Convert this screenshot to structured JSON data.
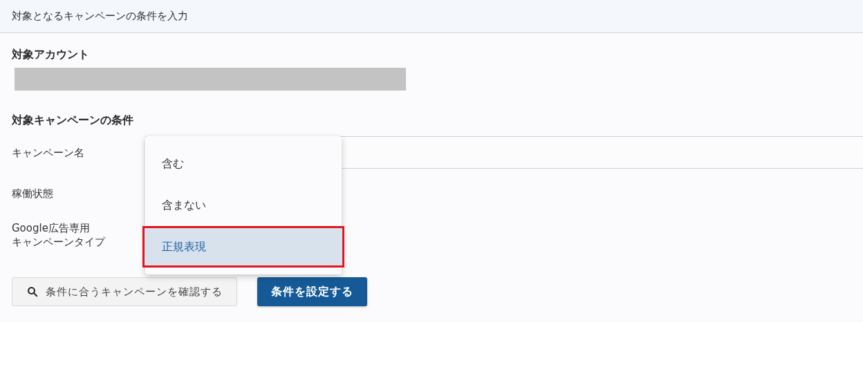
{
  "header": {
    "title": "対象となるキャンペーンの条件を入力"
  },
  "account": {
    "label": "対象アカウント"
  },
  "conditions": {
    "heading": "対象キャンペーンの条件",
    "fields": [
      {
        "lines": [
          "キャンペーン名"
        ],
        "kind": "text"
      },
      {
        "lines": [
          "稼働状態"
        ],
        "kind": "none"
      },
      {
        "lines": [
          "Google広告専用",
          "キャンペーンタイプ"
        ],
        "kind": "none"
      }
    ]
  },
  "dropdown": {
    "options": [
      {
        "label": "含む",
        "selected": false
      },
      {
        "label": "含まない",
        "selected": false
      },
      {
        "label": "正規表現",
        "selected": true
      }
    ]
  },
  "buttons": [
    {
      "kind": "secondary",
      "label": "条件に合うキャンペーンを確認する"
    },
    {
      "kind": "primary",
      "label": "条件を設定する"
    }
  ]
}
